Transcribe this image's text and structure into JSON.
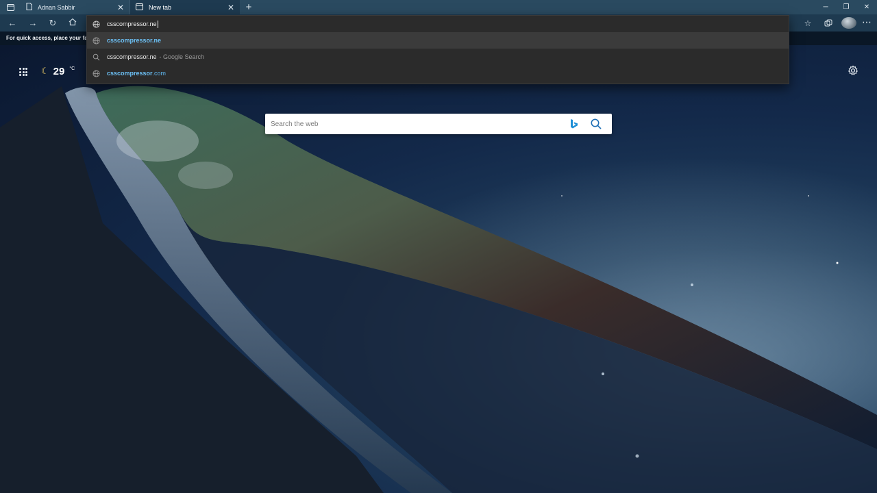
{
  "tabs": [
    {
      "title": "Adnan Sabbir",
      "active": false
    },
    {
      "title": "New tab",
      "active": true
    }
  ],
  "icons": {
    "tab_actions": "tab-actions-icon",
    "page": "page-icon",
    "newtab_page": "newtab-icon",
    "close": "close-icon",
    "new_tab": "plus-icon",
    "back": "back-arrow-icon",
    "forward": "forward-arrow-icon",
    "refresh": "refresh-icon",
    "home": "home-icon",
    "favorites": "star-icon",
    "collections": "collections-icon",
    "apps": "apps-grid-icon",
    "weather": "moon-icon",
    "settings": "gear-icon",
    "bing": "bing-icon",
    "search": "search-icon"
  },
  "window": {
    "minimize": "─",
    "maximize": "❐",
    "close": "✕"
  },
  "favbar": {
    "text": "For quick access, place your favo"
  },
  "omnibox": {
    "value": "csscompressor.ne",
    "suggestions": [
      {
        "text": "csscompressor.ne",
        "hint": "",
        "type": "url",
        "highlighted": true
      },
      {
        "text": "csscompressor.ne",
        "hint": "- Google Search",
        "type": "search",
        "highlighted": false
      },
      {
        "bold": "csscompressor",
        "rest": ".com",
        "type": "url",
        "highlighted": false
      }
    ]
  },
  "weather": {
    "temp": "29",
    "unit": "°C"
  },
  "search": {
    "placeholder": "Search the web"
  },
  "colors": {
    "accent_blue": "#5fb6ef",
    "toolbar": "#1e3a50",
    "tabstrip": "#2a4a60",
    "omnibox_bg": "#2b2b2b"
  }
}
